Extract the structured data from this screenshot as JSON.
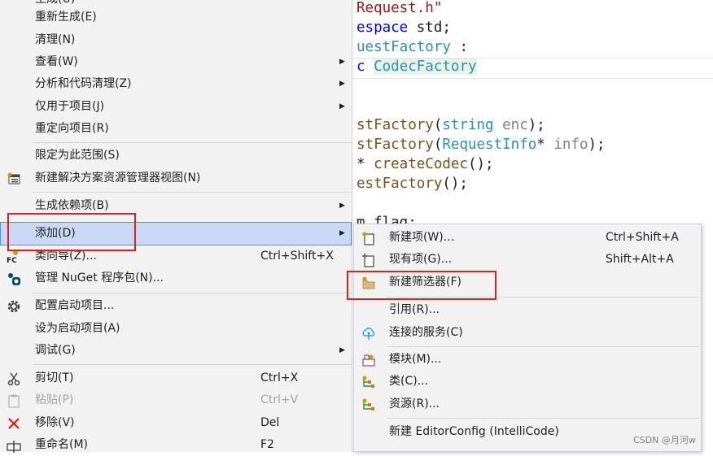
{
  "editor": {
    "lines": [
      {
        "segments": [
          {
            "t": "Request.h\"",
            "c": "tk-str"
          }
        ]
      },
      {
        "segments": [
          {
            "t": "espace",
            "c": "tk-kw"
          },
          {
            "t": " std;",
            "c": ""
          }
        ]
      },
      {
        "segments": [
          {
            "t": "uestFactory",
            "c": "tk-type"
          },
          {
            "t": " :",
            "c": ""
          }
        ]
      },
      {
        "segments": [
          {
            "t": "c",
            "c": "tk-kw"
          },
          {
            "t": " ",
            "c": ""
          },
          {
            "t": "CodecFactory",
            "c": "tk-sel"
          }
        ]
      },
      {
        "segments": []
      },
      {
        "segments": []
      },
      {
        "segments": [
          {
            "t": "stFactory",
            "c": "tk-fn"
          },
          {
            "t": "(",
            "c": ""
          },
          {
            "t": "string",
            "c": "tk-type"
          },
          {
            "t": " ",
            "c": ""
          },
          {
            "t": "enc",
            "c": "tk-param"
          },
          {
            "t": ");",
            "c": ""
          }
        ]
      },
      {
        "segments": [
          {
            "t": "stFactory",
            "c": "tk-fn"
          },
          {
            "t": "(",
            "c": ""
          },
          {
            "t": "RequestInfo",
            "c": "tk-type"
          },
          {
            "t": "* ",
            "c": ""
          },
          {
            "t": "info",
            "c": "tk-param"
          },
          {
            "t": ");",
            "c": ""
          }
        ]
      },
      {
        "segments": [
          {
            "t": "* ",
            "c": ""
          },
          {
            "t": "createCodec",
            "c": "tk-fn"
          },
          {
            "t": "();",
            "c": ""
          }
        ]
      },
      {
        "segments": [
          {
            "t": "estFactory",
            "c": "tk-fn"
          },
          {
            "t": "();",
            "c": ""
          }
        ]
      },
      {
        "segments": []
      },
      {
        "segments": [
          {
            "t": "m flag:",
            "c": ""
          }
        ]
      }
    ]
  },
  "menu": {
    "top_partial": "生成(U)",
    "items": {
      "rebuild": "重新生成(E)",
      "clean": "清理(N)",
      "view": "查看(W)",
      "analyze": "分析和代码清理(Z)",
      "project_only": "仅用于项目(J)",
      "retarget": "重定向项目(R)",
      "scope": "限定为此范围(S)",
      "new_explorer_view": "新建解决方案资源管理器视图(N)",
      "build_deps": "生成依赖项(B)",
      "add": "添加(D)",
      "class_wizard": "类向导(Z)...",
      "class_wizard_shortcut": "Ctrl+Shift+X",
      "nuget": "管理 NuGet 程序包(N)...",
      "config_startup": "配置启动项目...",
      "set_startup": "设为启动项目(A)",
      "debug": "调试(G)",
      "cut": "剪切(T)",
      "cut_shortcut": "Ctrl+X",
      "paste": "粘贴(P)",
      "paste_shortcut": "Ctrl+V",
      "remove": "移除(V)",
      "remove_shortcut": "Del",
      "rename": "重命名(M)",
      "rename_shortcut": "F2"
    }
  },
  "submenu": {
    "new_item": "新建项(W)...",
    "new_item_shortcut": "Ctrl+Shift+A",
    "existing_item": "现有项(G)...",
    "existing_item_shortcut": "Shift+Alt+A",
    "new_filter": "新建筛选器(F)",
    "reference": "引用(R)...",
    "connected_service": "连接的服务(C)",
    "module": "模块(M)...",
    "class": "类(C)...",
    "resource": "资源(R)...",
    "editorconfig": "新建 EditorConfig (IntelliCode)"
  },
  "colors": {
    "highlight_border": "#e02020",
    "active_item_bg": "#c9d8f5",
    "active_item_border": "#3399ff"
  },
  "watermark": "CSDN @月河w"
}
